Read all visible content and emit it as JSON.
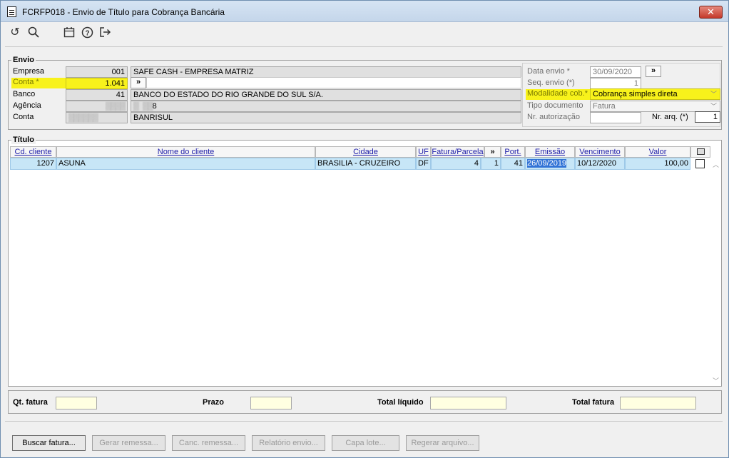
{
  "window": {
    "title": "FCRFP018 - Envio de Título para Cobrança Bancária",
    "close": "✕"
  },
  "toolbar": {
    "undo_icon": "↺",
    "search_icon": "⚲",
    "calendar_icon": "▦",
    "help_icon": "?",
    "exit_icon": "⇥"
  },
  "envio": {
    "group_label": "Envio",
    "empresa_label": "Empresa",
    "empresa_code": "001",
    "empresa_name": "SAFE CASH - EMPRESA MATRIZ",
    "conta_label": "Conta *",
    "conta_value": "1.041",
    "conta_btn": "»",
    "banco_label": "Banco",
    "banco_code": "41",
    "banco_name": "BANCO DO ESTADO DO RIO GRANDE DO SUL S/A.",
    "agencia_label": "Agência",
    "agencia_value": "8",
    "conta2_label": "Conta",
    "conta2_name": "BANRISUL",
    "data_envio_label": "Data envio *",
    "data_envio_value": "30/09/2020",
    "data_envio_btn": "»",
    "seq_envio_label": "Seq. envio (*)",
    "seq_envio_value": "1",
    "modalidade_label": "Modalidade cob.*",
    "modalidade_value": "Cobrança simples direta",
    "tipo_doc_label": "Tipo documento",
    "tipo_doc_value": "Fatura",
    "nr_aut_label": "Nr. autorização",
    "nr_aut_value": "",
    "nr_arq_label": "Nr. arq. (*)",
    "nr_arq_value": "1"
  },
  "titulo": {
    "group_label": "Título",
    "columns": {
      "cd_cliente": "Cd. cliente",
      "nome": "Nome do cliente",
      "cidade": "Cidade",
      "uf": "UF",
      "fatura": "Fatura/Parcela",
      "more": "»",
      "port": "Port.",
      "emissao": "Emissão",
      "vencimento": "Vencimento",
      "valor": "Valor"
    },
    "rows": [
      {
        "cd_cliente": "1207",
        "nome": "ASUNA",
        "cidade": "BRASILIA - CRUZEIRO",
        "uf": "DF",
        "fatura": "4",
        "parcela": "1",
        "port": "41",
        "emissao": "26/09/2019",
        "vencimento": "10/12/2020",
        "valor": "100,00"
      }
    ]
  },
  "totals": {
    "qt_fatura_label": "Qt. fatura",
    "prazo_label": "Prazo",
    "total_liquido_label": "Total líquido",
    "total_fatura_label": "Total fatura"
  },
  "buttons": {
    "buscar": "Buscar fatura...",
    "gerar": "Gerar remessa...",
    "canc": "Canc. remessa...",
    "relatorio": "Relatório envio...",
    "capa": "Capa lote...",
    "regerar": "Regerar arquivo..."
  }
}
